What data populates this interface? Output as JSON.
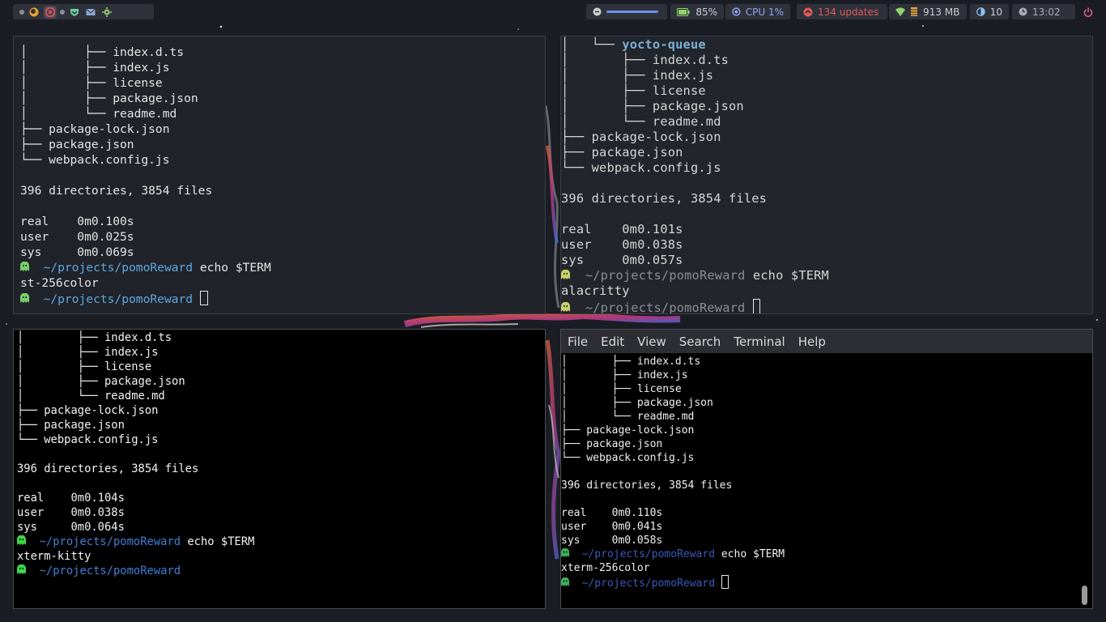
{
  "bar": {
    "volume_percent": 100,
    "battery": "85%",
    "cpu": "CPU 1%",
    "updates": "134 updates",
    "memory": "913 MB",
    "brightness": "10",
    "clock": "13:02",
    "colors": {
      "bar_bg": "#2f323a",
      "accent_blue": "#6a8ff0",
      "updates_red": "#e05a5a",
      "battery_green": "#8ed36a"
    }
  },
  "terminals": [
    {
      "type": "st",
      "lines": [
        "│        ├── index.d.ts",
        "│        ├── index.js",
        "│        ├── license",
        "│        ├── package.json",
        "│        └── readme.md",
        "├── package-lock.json",
        "├── package.json",
        "└── webpack.config.js",
        "",
        "396 directories, 3854 files",
        "",
        "real    0m0.100s",
        "user    0m0.025s",
        "sys     0m0.069s"
      ],
      "prompt_path": "~/projects/pomoReward",
      "command": "echo $TERM",
      "output": "st-256color"
    },
    {
      "type": "alacritty",
      "dir_line_prefix": "│   └── ",
      "dir_name": "yocto-queue",
      "lines": [
        "│       ├── index.d.ts",
        "│       ├── index.js",
        "│       ├── license",
        "│       ├── package.json",
        "│       └── readme.md",
        "├── package-lock.json",
        "├── package.json",
        "└── webpack.config.js",
        "",
        "396 directories, 3854 files",
        "",
        "real    0m0.101s",
        "user    0m0.038s",
        "sys     0m0.057s"
      ],
      "prompt_path": "~/projects/pomoReward",
      "command": "echo $TERM",
      "output": "alacritty"
    },
    {
      "type": "kitty",
      "lines": [
        "│        ├── index.d.ts",
        "│        ├── index.js",
        "│        ├── license",
        "│        ├── package.json",
        "│        └── readme.md",
        "├── package-lock.json",
        "├── package.json",
        "└── webpack.config.js",
        "",
        "396 directories, 3854 files",
        "",
        "real    0m0.104s",
        "user    0m0.038s",
        "sys     0m0.064s"
      ],
      "prompt_path": "~/projects/pomoReward",
      "command": "echo $TERM",
      "output": "xterm-kitty"
    },
    {
      "type": "gnome-terminal",
      "menu": [
        "File",
        "Edit",
        "View",
        "Search",
        "Terminal",
        "Help"
      ],
      "lines": [
        "│       ├── index.d.ts",
        "│       ├── index.js",
        "│       ├── license",
        "│       ├── package.json",
        "│       └── readme.md",
        "├── package-lock.json",
        "├── package.json",
        "└── webpack.config.js",
        "",
        "396 directories, 3854 files",
        "",
        "real    0m0.110s",
        "user    0m0.041s",
        "sys     0m0.058s"
      ],
      "prompt_path": "~/projects/pomoReward",
      "command": "echo $TERM",
      "output": "xterm-256color"
    }
  ]
}
